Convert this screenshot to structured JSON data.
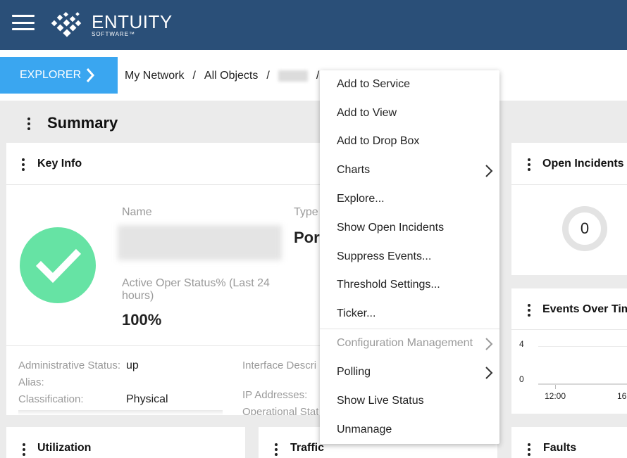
{
  "header": {
    "brand_name": "ENTUITY",
    "brand_sub": "SOFTWARE™"
  },
  "breadcrumb": {
    "explorer_label": "EXPLORER",
    "items": [
      "My Network",
      "All Objects"
    ],
    "separator": "/"
  },
  "summary": {
    "title": "Summary"
  },
  "key_info": {
    "title": "Key Info",
    "name_label": "Name",
    "type_label": "Type",
    "type_value": "Por",
    "active_oper_label": "Active Oper Status% (Last 24 hours)",
    "active_oper_value": "100%",
    "admin_status_label": "Administrative Status:",
    "admin_status_value": "up",
    "alias_label": "Alias:",
    "classification_label": "Classification:",
    "classification_value": "Physical",
    "interface_desc_label": "Interface Descri",
    "ip_addresses_label": "IP Addresses:",
    "oper_status_label": "Operational Stat"
  },
  "open_incidents": {
    "title": "Open Incidents",
    "count": "0"
  },
  "events_over_time": {
    "title": "Events Over Time",
    "y_ticks": [
      "4",
      "0"
    ],
    "x_ticks": [
      "12:00",
      "16"
    ]
  },
  "bottom_panels": {
    "utilization": "Utilization",
    "traffic": "Traffic",
    "faults": "Faults"
  },
  "context_menu": {
    "items": [
      {
        "label": "Add to Service",
        "submenu": false,
        "disabled": false
      },
      {
        "label": "Add to View",
        "submenu": false,
        "disabled": false
      },
      {
        "label": "Add to Drop Box",
        "submenu": false,
        "disabled": false
      },
      {
        "label": "Charts",
        "submenu": true,
        "disabled": false
      },
      {
        "label": "Explore...",
        "submenu": false,
        "disabled": false
      },
      {
        "label": "Show Open Incidents",
        "submenu": false,
        "disabled": false
      },
      {
        "label": "Suppress Events...",
        "submenu": false,
        "disabled": false
      },
      {
        "label": "Threshold Settings...",
        "submenu": false,
        "disabled": false
      },
      {
        "label": "Ticker...",
        "submenu": false,
        "disabled": false
      },
      {
        "label": "Configuration Management",
        "submenu": true,
        "disabled": true
      },
      {
        "label": "Polling",
        "submenu": true,
        "disabled": false
      },
      {
        "label": "Show Live Status",
        "submenu": false,
        "disabled": false
      },
      {
        "label": "Unmanage",
        "submenu": false,
        "disabled": false
      }
    ]
  },
  "colors": {
    "topbar": "#2a4f78",
    "explorer_button": "#3aa6f0",
    "status_ok": "#66e3a4"
  }
}
